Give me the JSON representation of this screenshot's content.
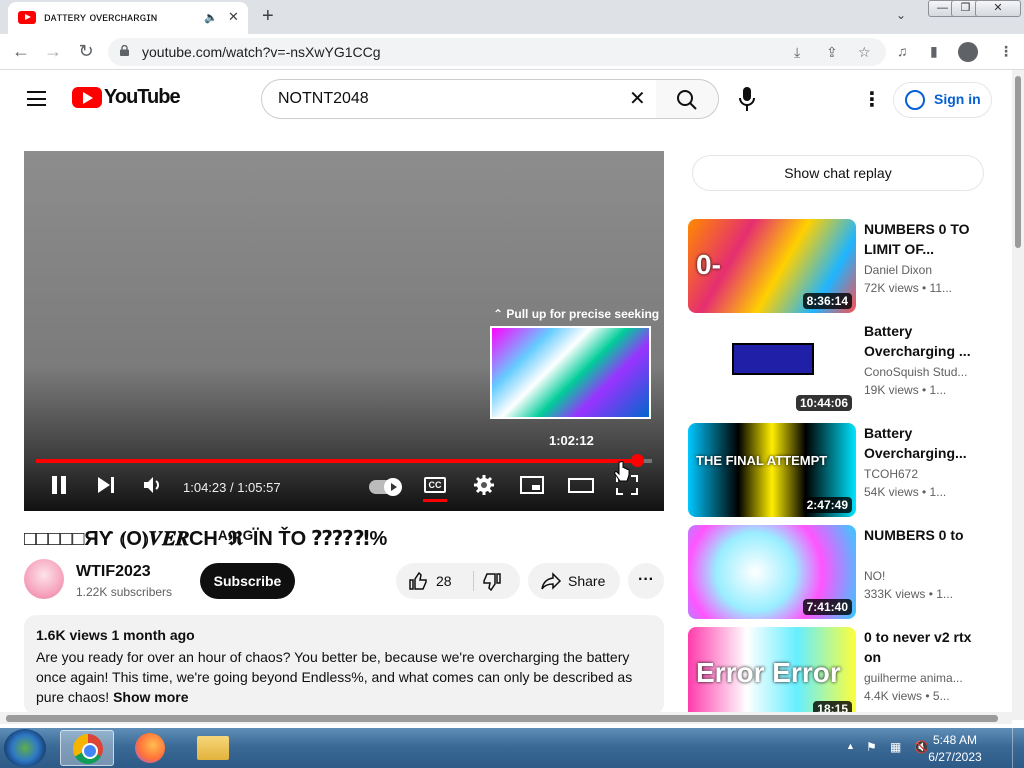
{
  "browser": {
    "tab_title": "ᴅᴀᴛᴛᴇʀʏ ᴏᴠᴇʀᴄʜᴀʀɢɪɴ",
    "url": "youtube.com/watch?v=-nsXwYG1CCg"
  },
  "youtube": {
    "logo_text": "YouTube",
    "search_query": "NOTNT2048",
    "sign_in": "Sign in"
  },
  "player": {
    "seek_hint": "Pull up for precise seeking",
    "preview_time": "1:02:12",
    "time_display": "1:04:23 / 1:05:57",
    "progress": 0.976,
    "cc_label": "CC"
  },
  "video": {
    "title": "□□□□□ЯƳ ⦅O⦆𝑽𝑬𝑹CHᴬ𝕽ᴳÏN ŤO ⁇⁇⁈%",
    "channel": "WTIF2023",
    "subscribers": "1.22K subscribers",
    "subscribe_label": "Subscribe",
    "likes": "28",
    "share_label": "Share",
    "description_meta": "1.6K views  1 month ago",
    "description": "Are you ready for over an hour of chaos? You better be, because we're overcharging the battery once again! This time, we're going beyond Endless%, and what comes can only be described as pure chaos!",
    "show_more": "Show more",
    "chat_replay": "Show chat replay"
  },
  "recommendations": [
    {
      "title": "NUMBERS 0 TO LIMIT OF...",
      "channel": "Daniel Dixon",
      "views": "72K views • 11...",
      "duration": "8:36:14",
      "thumb": "linear-gradient(120deg,#ff8a00,#e52e71 30%,#ffd000 55%,#1fb5ff 80%,#ff4d4d)",
      "thumb_text": "0-"
    },
    {
      "title": "Battery Overcharging ...",
      "channel": "ConoSquish Stud...",
      "views": "19K views • 1...",
      "duration": "10:44:06",
      "thumb": "linear-gradient(#ffffff,#ffffff)",
      "thumb_text": ""
    },
    {
      "title": "Battery Overcharging...",
      "channel": "TCOH672",
      "views": "54K views • 1...",
      "duration": "2:47:49",
      "thumb": "linear-gradient(90deg,#00c8ff,#000 30%,#ffee00 50%,#000 70%,#00e5ff)",
      "thumb_text": "THE FINAL ATTEMPT"
    },
    {
      "title": "NUMBERS 0 to",
      "channel": "NO!",
      "views": "333K views • 1...",
      "duration": "7:41:40",
      "thumb": "radial-gradient(circle at 40% 50%,#fff 0%,#9ef 35%,#f5f 60%,#3cf 100%)",
      "thumb_text": ""
    },
    {
      "title": "0 to never v2 rtx on",
      "channel": "guilherme anima...",
      "views": "4.4K views • 5...",
      "duration": "18:15",
      "thumb": "linear-gradient(90deg,#ff3cac,#ffffff 35%,#6ef 65%,#fdff3c)",
      "thumb_text": "Error Error"
    }
  ],
  "taskbar": {
    "time": "5:48 AM",
    "date": "6/27/2023"
  }
}
